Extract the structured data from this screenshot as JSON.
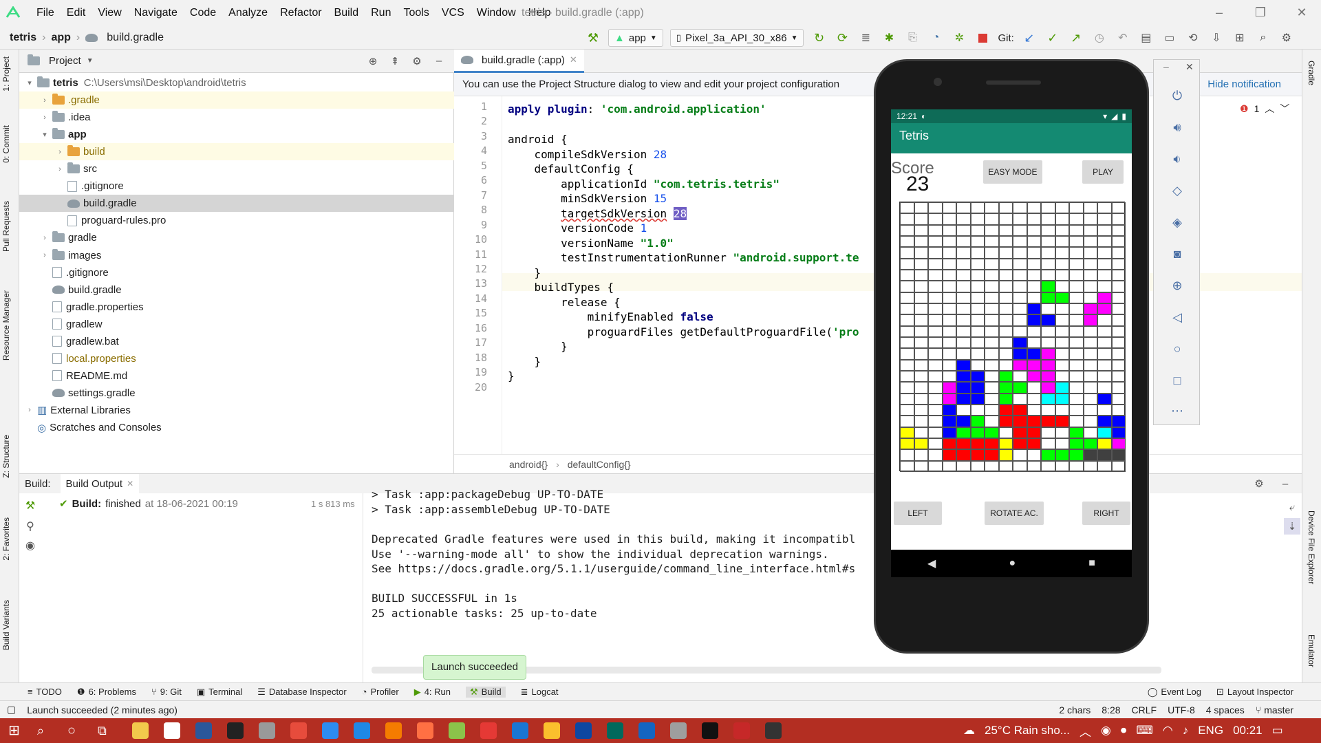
{
  "menubar": {
    "items": [
      "File",
      "Edit",
      "View",
      "Navigate",
      "Code",
      "Analyze",
      "Refactor",
      "Build",
      "Run",
      "Tools",
      "VCS",
      "Window",
      "Help"
    ],
    "window_title": "tetris - build.gradle (:app)"
  },
  "navbar": {
    "crumbs": [
      "tetris",
      "app",
      "build.gradle"
    ],
    "run_config": "app",
    "device": "Pixel_3a_API_30_x86",
    "git_label": "Git:"
  },
  "project_panel": {
    "title": "Project",
    "tree": [
      {
        "label": "tetris",
        "extra": "C:\\Users\\msi\\Desktop\\android\\tetris",
        "bold": true
      },
      {
        "label": ".gradle"
      },
      {
        "label": ".idea"
      },
      {
        "label": "app",
        "bold": true
      },
      {
        "label": "build"
      },
      {
        "label": "src"
      },
      {
        "label": ".gitignore"
      },
      {
        "label": "build.gradle"
      },
      {
        "label": "proguard-rules.pro"
      },
      {
        "label": "gradle"
      },
      {
        "label": "images"
      },
      {
        "label": ".gitignore"
      },
      {
        "label": "build.gradle"
      },
      {
        "label": "gradle.properties"
      },
      {
        "label": "gradlew"
      },
      {
        "label": "gradlew.bat"
      },
      {
        "label": "local.properties"
      },
      {
        "label": "README.md"
      },
      {
        "label": "settings.gradle"
      },
      {
        "label": "External Libraries"
      },
      {
        "label": "Scratches and Consoles"
      }
    ]
  },
  "left_strip": [
    "1: Project",
    "0: Commit",
    "Pull Requests",
    "Resource Manager",
    "Z: Structure",
    "2: Favorites",
    "Build Variants"
  ],
  "right_strip": [
    "Gradle",
    "Device File Explorer",
    "Emulator"
  ],
  "editor": {
    "tab": "build.gradle (:app)",
    "notice": "You can use the Project Structure dialog to view and edit your project configuration",
    "notice_action": "Hide notification",
    "warning_count": "1",
    "line_numbers": [
      "1",
      "2",
      "3",
      "4",
      "5",
      "6",
      "7",
      "8",
      "9",
      "10",
      "11",
      "12",
      "13",
      "14",
      "15",
      "16",
      "17",
      "18",
      "19",
      "20"
    ],
    "breadcrumb": [
      "android{}",
      "defaultConfig{}"
    ]
  },
  "build_panel": {
    "tabs": [
      "Build:",
      "Build Output"
    ],
    "status_word": "Build:",
    "status_text": "finished",
    "status_date": "at 18-06-2021 00:19",
    "duration": "1 s 813 ms",
    "log": [
      "> Task :app:packageDebug UP-TO-DATE",
      "> Task :app:assembleDebug UP-TO-DATE",
      "",
      "Deprecated Gradle features were used in this build, making it incompatibl",
      "Use '--warning-mode all' to show the individual deprecation warnings.",
      "See https://docs.gradle.org/5.1.1/userguide/command_line_interface.html#s",
      "",
      "BUILD SUCCESSFUL in 1s",
      "25 actionable tasks: 25 up-to-date"
    ],
    "toast": "Launch succeeded"
  },
  "bottom_tabs": [
    "TODO",
    "6: Problems",
    "9: Git",
    "Terminal",
    "Database Inspector",
    "Profiler",
    "4: Run",
    "Build",
    "Logcat",
    "Event Log",
    "Layout Inspector"
  ],
  "status_bar": {
    "message": "Launch succeeded (2 minutes ago)",
    "chars": "2 chars",
    "position": "8:28",
    "line_sep": "CRLF",
    "encoding": "UTF-8",
    "indent": "4 spaces",
    "branch": "master"
  },
  "phone": {
    "time": "12:21",
    "app_title": "Tetris",
    "score_label": "Score",
    "score": "23",
    "btn_easy": "EASY MODE",
    "btn_play": "PLAY",
    "btn_left": "LEFT",
    "btn_rotate": "ROTATE AC.",
    "btn_right": "RIGHT"
  },
  "taskbar": {
    "weather": "25°C  Rain sho...",
    "lang": "ENG",
    "clock": "00:21"
  },
  "colors": {
    "accent_green": "#148a72",
    "toast_bg": "#d6f5d0",
    "taskbar": "#b32e22",
    "board_blue": "#0000ff",
    "board_red": "#ff0000",
    "board_green": "#00ff00",
    "board_yellow": "#ffff00",
    "board_magenta": "#ff00ff",
    "board_cyan": "#00ffff",
    "board_dark": "#404040"
  }
}
